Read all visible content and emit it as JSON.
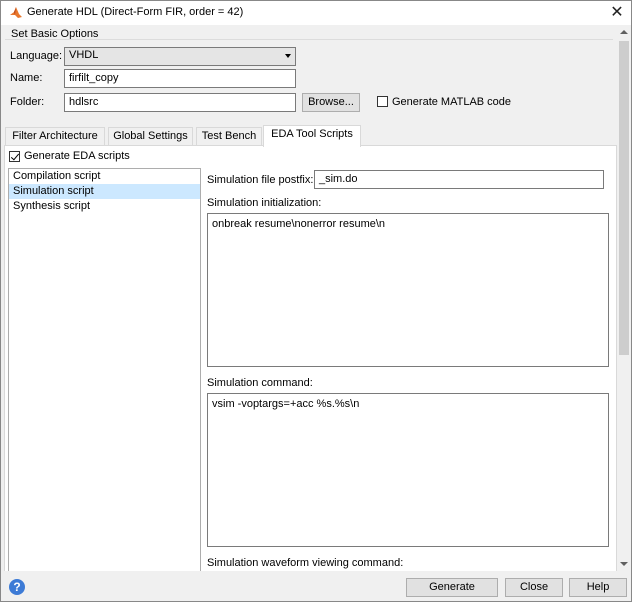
{
  "window": {
    "title": "Generate HDL (Direct-Form FIR, order = 42)",
    "close_glyph": "✕"
  },
  "basic": {
    "section_title": "Set Basic Options",
    "language_label": "Language:",
    "language_value": "VHDL",
    "name_label": "Name:",
    "name_value": "firfilt_copy",
    "folder_label": "Folder:",
    "folder_value": "hdlsrc",
    "browse_label": "Browse...",
    "generate_matlab_label": "Generate MATLAB code",
    "generate_matlab_checked": false
  },
  "tabs": [
    {
      "label": "Filter Architecture",
      "active": false
    },
    {
      "label": "Global Settings",
      "active": false
    },
    {
      "label": "Test Bench",
      "active": false
    },
    {
      "label": "EDA Tool Scripts",
      "active": true
    }
  ],
  "eda": {
    "generate_scripts_label": "Generate EDA scripts",
    "generate_scripts_checked": true,
    "script_list": [
      {
        "label": "Compilation script",
        "selected": false
      },
      {
        "label": "Simulation script",
        "selected": true
      },
      {
        "label": "Synthesis script",
        "selected": false
      }
    ],
    "postfix_label": "Simulation file postfix:",
    "postfix_value": "_sim.do",
    "init_label": "Simulation initialization:",
    "init_value": "onbreak resume\\nonerror resume\\n",
    "command_label": "Simulation command:",
    "command_value": "vsim -voptargs=+acc %s.%s\\n",
    "waveform_label": "Simulation waveform viewing command:"
  },
  "footer": {
    "help_glyph": "?",
    "generate_label": "Generate",
    "close_label": "Close",
    "help_label": "Help"
  },
  "colors": {
    "selection": "#cce8ff",
    "help_icon": "#3d7bd6",
    "matlab_icon": "#e8772e"
  }
}
